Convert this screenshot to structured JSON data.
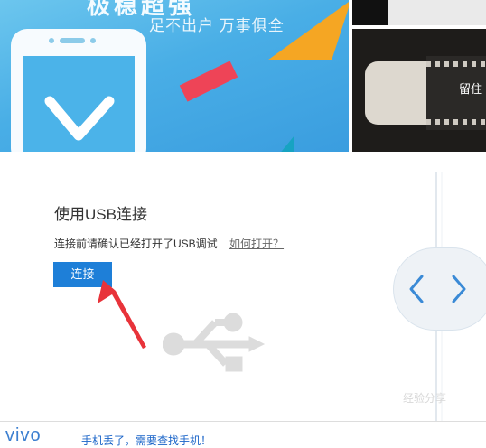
{
  "banner": {
    "tagline_top": "极稳超强",
    "tagline": "足不出户 万事俱全",
    "side_text": "留住"
  },
  "usb": {
    "title": "使用USB连接",
    "hint": "连接前请确认已经打开了USB调试",
    "help_link": "如何打开？",
    "connect_button": "连接"
  },
  "watermark": "经验分享",
  "footer": {
    "logo": "vivo",
    "link": "手机丢了，需要查找手机！"
  },
  "colors": {
    "accent": "#1e7fd8",
    "annotation_arrow": "#e8333a",
    "banner_blue": "#49aee6"
  },
  "icons": [
    "usb-icon",
    "chevron-left-icon",
    "chevron-right-icon",
    "checkmark-icon"
  ]
}
